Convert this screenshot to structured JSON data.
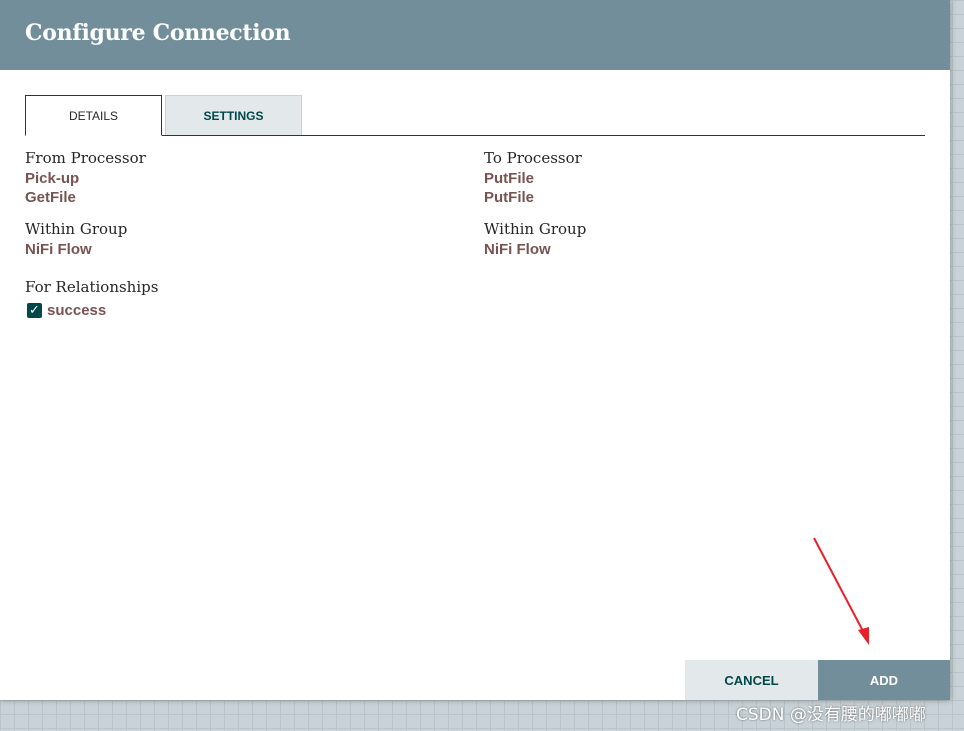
{
  "dialog": {
    "title": "Configure Connection",
    "tabs": [
      {
        "label": "DETAILS",
        "active": true
      },
      {
        "label": "SETTINGS",
        "active": false
      }
    ],
    "from": {
      "label": "From Processor",
      "processor_name": "Pick-up",
      "processor_type": "GetFile",
      "group_label": "Within Group",
      "group_name": "NiFi Flow"
    },
    "to": {
      "label": "To Processor",
      "processor_name": "PutFile",
      "processor_type": "PutFile",
      "group_label": "Within Group",
      "group_name": "NiFi Flow"
    },
    "relationships": {
      "label": "For Relationships",
      "items": [
        {
          "name": "success",
          "checked": true
        }
      ]
    },
    "buttons": {
      "cancel_label": "CANCEL",
      "add_label": "ADD"
    }
  },
  "annotation": {
    "arrow_color": "#e8202a",
    "watermark": "CSDN @没有腰的嘟嘟嘟"
  },
  "colors": {
    "header": "#728e9b",
    "accent": "#004849",
    "value_text": "#775351"
  }
}
